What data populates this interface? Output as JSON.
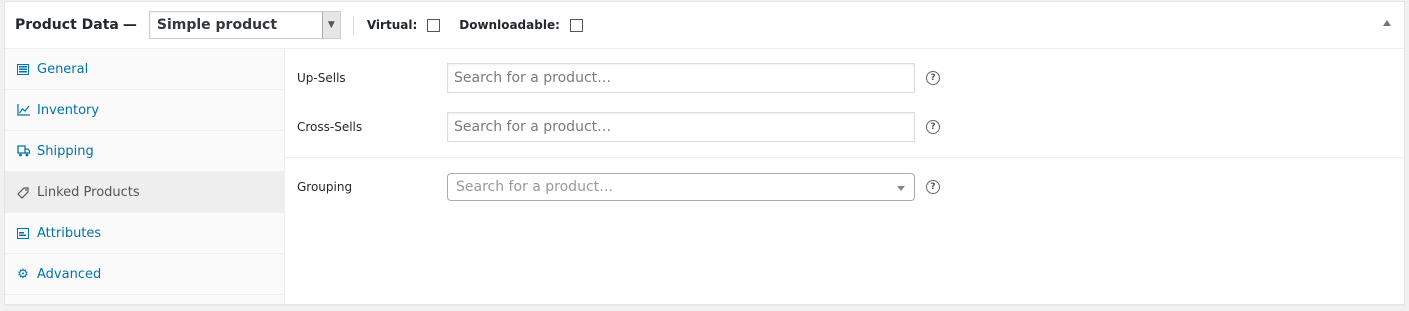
{
  "header": {
    "title": "Product Data",
    "dash": "—",
    "product_type": "Simple product",
    "virtual_label": "Virtual:",
    "downloadable_label": "Downloadable:"
  },
  "tabs": [
    {
      "label": "General",
      "icon": "table-icon"
    },
    {
      "label": "Inventory",
      "icon": "chart-line-icon"
    },
    {
      "label": "Shipping",
      "icon": "truck-icon"
    },
    {
      "label": "Linked Products",
      "icon": "link-icon"
    },
    {
      "label": "Attributes",
      "icon": "list-icon"
    },
    {
      "label": "Advanced",
      "icon": "gear-icon"
    }
  ],
  "active_tab": "Linked Products",
  "fields": {
    "upsells": {
      "label": "Up-Sells",
      "placeholder": "Search for a product…"
    },
    "crosssells": {
      "label": "Cross-Sells",
      "placeholder": "Search for a product…"
    },
    "grouping": {
      "label": "Grouping",
      "placeholder": "Search for a product…"
    }
  },
  "colors": {
    "link": "#0073aa",
    "border": "#eee",
    "active_tab_bg": "#eee"
  }
}
